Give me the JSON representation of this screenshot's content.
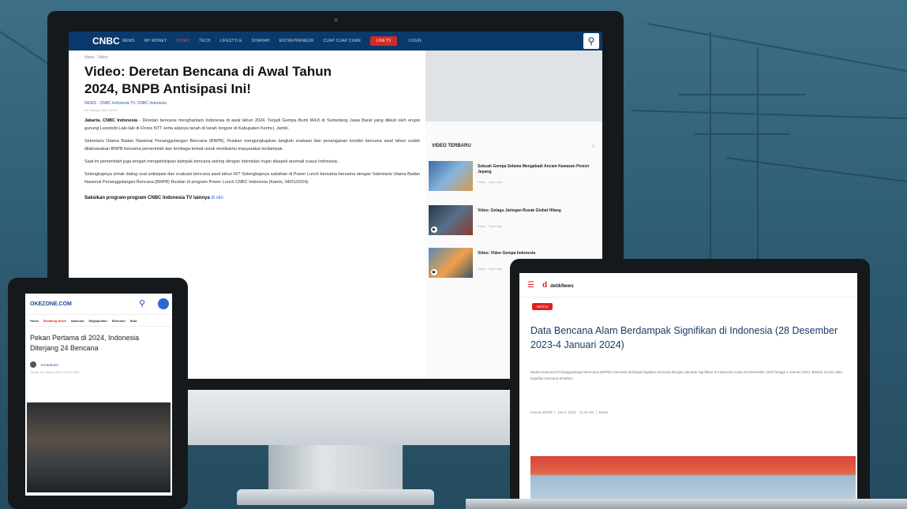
{
  "monitor": {
    "nav": {
      "items": [
        "NEWS",
        "MY MONEY",
        "VIDEO",
        "TECH",
        "LIFESTYLE",
        "SYARIAH",
        "ENTREPRENEUR",
        "CUAP CUAP CUAN"
      ],
      "live_label": "LIVE TV",
      "login_label": "LOGIN",
      "logo": "CNBC"
    },
    "article": {
      "breadcrumb": "News · Video",
      "headline_line1": "Video: Deretan Bencana di Awal Tahun",
      "headline_line2": "2024, BNPB Antisipasi Ini!",
      "byline": "NEWS · CNBC Indonesia TV, CNBC Indonesia",
      "dateline": "04 January 2024 10:00",
      "lead_bold": "Jakarta, CNBC Indonesia",
      "lead": " - Deretan bencana menghantam Indonesia di awal tahun 2024. Terjadi Gempa Bumi M4,8 di Sumedang Jawa Barat yang diikuti oleh erupsi gunung Lewotobi Laki-laki di Flores NTT serta adanya tanah di tanah longsor di Kabupaten Kerinci, Jambi.",
      "para2": "Sekretaris Utama Badan Nasional Penanggulangan Bencana (BNPB), Rustian mengungkapkan langkah evaluasi dan penanganan kondisi bencana awal tahun sudah dilaksanakan BNPB bersama pemerintah dan lembaga terkait untuk membantu masyarakat terdampak.",
      "para3": "Saat ini pemerintah juga tengah mengantisipasi dampak bencana seiring dengan intensitas hujan diaspek anomali cuaca Indonesia.",
      "para4": "Selengkapnya simak dialog soal antisipasi dan evaluasi bencana awal tahun RI? Selengkapnya saksikan di Power Lunch bersama bersama dengan Sekretaris Utama Badan Nasional Penanggulangan Bencana (BNPB) Rustian di program Power Lunch CNBC Indonesia (Kamis, 04/01/2024).",
      "promo_text": "Saksikan program-program CNBC Indonesia TV lainnya",
      "promo_link": "di sini"
    },
    "sidebar": {
      "videos_title": "VIDEO TERBARU",
      "videos": [
        {
          "title": "Sebuah Gempa Selama Mengabadi Ancam Kawasan Pesisir Jepang",
          "meta": "Video · 2 jam lalu"
        },
        {
          "title": "Video: Gelagu Jaringan Rusak Global Hilang",
          "meta": "Video · 3 jam lalu"
        },
        {
          "title": "Video: Video Gempa Indonesia",
          "meta": "Video · 5 jam lalu"
        }
      ]
    }
  },
  "tablet": {
    "logo_main": "OKE",
    "logo_sub": "ZONE.COM",
    "nav": [
      "Home",
      "Breaking News",
      "Nasional",
      "Megapolitan",
      "Ekonomi",
      "Bola"
    ],
    "title": "Pekan Pertama di 2024, Indonesia Diterjang 24 Bencana",
    "author": "Kontributor",
    "date": "Jumat, 05 Januari 2024 12:00 WIB"
  },
  "laptop": {
    "logo": "detikNews",
    "logo_mark": "d",
    "tag": "BERITA",
    "title": "Data Bencana Alam Berdampak Signifikan di Indonesia (28 Desember 2023-4 Januari 2024)",
    "desc": "Badan Nasional Penanggulangan Bencana (BNPB) mencatat berbagai kejadian bencana dengan dampak signifikan di Indonesia mulai 28 Desember 2023 hingga 4 Januari 2024. Berikut rincian data kejadian bencana tersebut.",
    "meta_author": "Humas BNPB",
    "meta_date": "Jan 5, 2024 · 11:30 AM",
    "meta_tag": "Berita"
  }
}
